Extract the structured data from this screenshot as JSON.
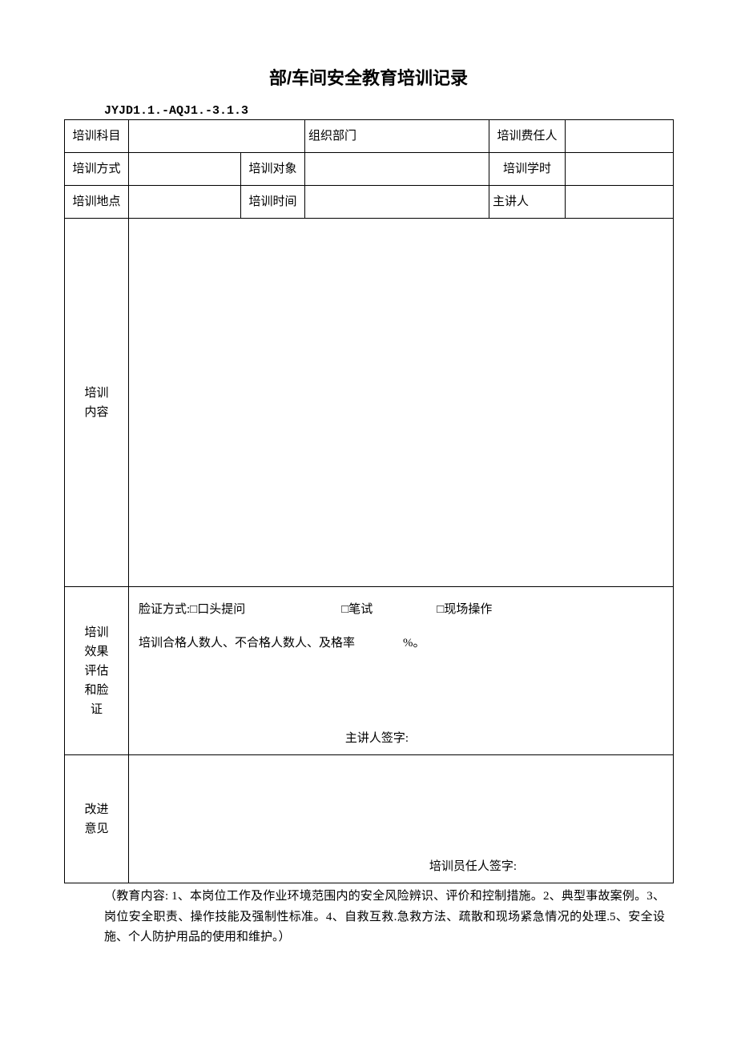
{
  "title": "部/车间安全教育培训记录",
  "code": "JYJD1.1.-AQJ1.-3.1.3",
  "rows": {
    "r1c1": "培训科目",
    "r1c2": "",
    "r1c3": "组织部门",
    "r1c4": "",
    "r1c5": "培训费任人",
    "r1c6": "",
    "r2c1": "培训方式",
    "r2c2": "",
    "r2c3": "培训对象",
    "r2c4": "",
    "r2c5": "培训学时",
    "r2c6": "",
    "r3c1": "培训地点",
    "r3c2": "",
    "r3c3": "培训时间",
    "r3c4": "",
    "r3c5": "主讲人",
    "r3c6": ""
  },
  "content_label": "培训\n内容",
  "effect_label": "培训\n效果\n评估\n和脸\n证",
  "effect_line1_prefix": "脸证方式:",
  "effect_opt1": "□口头提问",
  "effect_opt2": "□笔试",
  "effect_opt3": "□现场操作",
  "effect_line2": "培训合格人数人、不合格人数人、及格率　　　　%。",
  "effect_sign": "主讲人签字:",
  "improve_label": "改进\n意见",
  "improve_sign": "培训员任人签字:",
  "notes": "（教育内容: 1、本岗位工作及作业环境范围内的安全风险辨识、评价和控制措施。2、典型事故案例。3、岗位安全职责、操作技能及强制性标准。4、自救互救.急救方法、疏散和现场紧急情况的处理.5、安全设施、个人防护用品的使用和维护。）"
}
